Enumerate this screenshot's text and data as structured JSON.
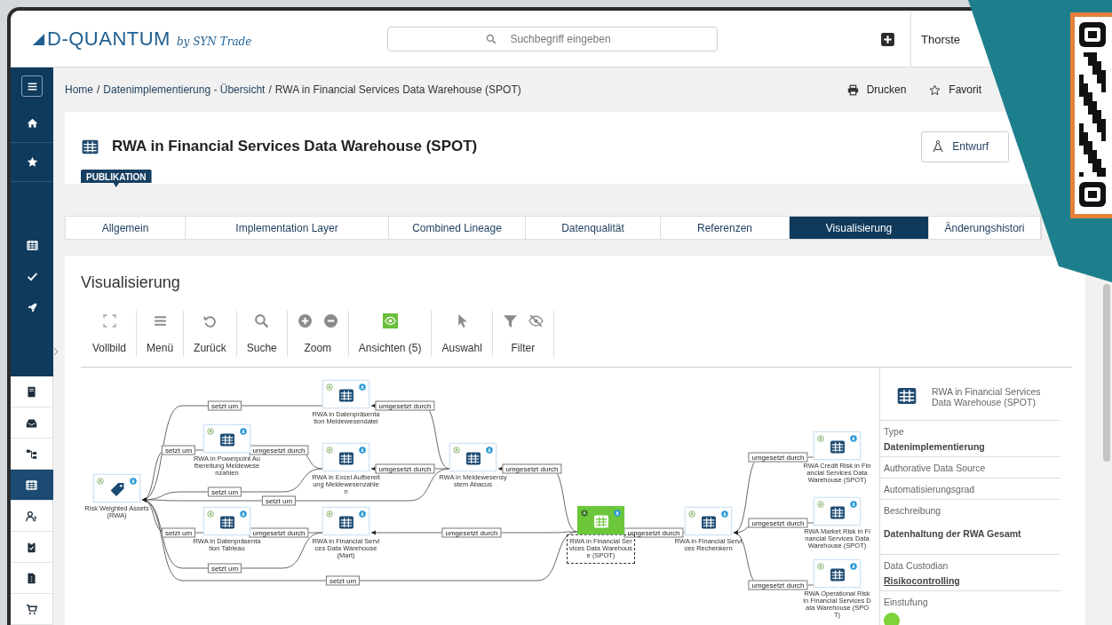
{
  "header": {
    "logo": "D-QUANTUM",
    "logo_tagline": "by SYN Trade",
    "search": {
      "placeholder": "Suchbegriff eingeben"
    },
    "user": "Thorste"
  },
  "sidebar": {
    "sections": [
      {
        "items": [
          {
            "selected": false
          },
          {
            "selected": false
          },
          {
            "selected": false
          }
        ]
      },
      {
        "items": [
          {
            "selected": false
          },
          {
            "selected": false
          },
          {
            "selected": false
          }
        ]
      },
      {
        "items": [
          {
            "selected": false
          },
          {
            "selected": false
          },
          {
            "selected": false
          },
          {
            "selected": true
          },
          {
            "selected": false
          },
          {
            "selected": false
          },
          {
            "selected": false
          },
          {
            "selected": false
          }
        ]
      }
    ]
  },
  "breadcrumb": [
    {
      "kind": "link",
      "label": "Home"
    },
    {
      "kind": "separator",
      "label": "/"
    },
    {
      "kind": "link",
      "label": "Datenimplementierung - Übersicht"
    },
    {
      "kind": "separator",
      "label": "/"
    },
    {
      "kind": "current",
      "label": "RWA in Financial Services Data Warehouse (SPOT)"
    }
  ],
  "actions": [
    "Drucken",
    "Favorit"
  ],
  "page": {
    "title": "RWA in Financial Services Data Warehouse (SPOT)",
    "status_badge": "PUBLIKATION",
    "button": "Entwurf"
  },
  "tabs": [
    {
      "label": "Allgemein",
      "selected": false
    },
    {
      "label": "Implementation Layer",
      "selected": false
    },
    {
      "label": "Combined Lineage",
      "selected": false
    },
    {
      "label": "Datenqualität",
      "selected": false
    },
    {
      "label": "Referenzen",
      "selected": false
    },
    {
      "label": "Visualisierung",
      "selected": true
    },
    {
      "label": "Änderungshistori",
      "selected": false
    }
  ],
  "visualization": {
    "heading": "Visualisierung",
    "toolbar": [
      {
        "label": "Vollbild",
        "active": false
      },
      {
        "label": "Menü",
        "active": false
      },
      {
        "label": "Zurück",
        "active": false
      },
      {
        "label": "Suche",
        "active": false
      },
      {
        "label": "Zoom",
        "active": false
      },
      {
        "label": "Ansichten (5)",
        "active": true
      },
      {
        "label": "Auswahl",
        "active": false
      },
      {
        "label": "Filter",
        "active": false
      }
    ],
    "graph": {
      "nodes": [
        {
          "kind": "asset",
          "label": "Risk Weighted Assets (RWA)",
          "selected": false
        },
        {
          "kind": "implementation",
          "label": "RWA in Datenpräsentation Meldewesendatei",
          "selected": false
        },
        {
          "kind": "implementation",
          "label": "RWA in Powerpoint Aufbereitung Meldewesenzahlen",
          "selected": false
        },
        {
          "kind": "implementation",
          "label": "RWA in Excel Aufbereitung Meldewesenzahlen",
          "selected": false
        },
        {
          "kind": "implementation",
          "label": "RWA in Datenpräsentation Tableau",
          "selected": false
        },
        {
          "kind": "implementation",
          "label": "RWA in Financial Services Data Warehouse (Mart)",
          "selected": false
        },
        {
          "kind": "implementation",
          "label": "RWA in Meldewesensystem Abacus",
          "selected": false
        },
        {
          "kind": "implementation",
          "label": "RWA in Financial Services Data Warehouse (SPOT)",
          "selected": true
        },
        {
          "kind": "implementation",
          "label": "RWA in Financial Services Rechenkern",
          "selected": false
        },
        {
          "kind": "implementation",
          "label": "RWA Credit Risk in Financial Services Data Warehouse (SPOT)",
          "selected": false
        },
        {
          "kind": "implementation",
          "label": "RWA Market Risk in Financial Services Data Warehouse (SPOT)",
          "selected": false
        },
        {
          "kind": "implementation",
          "label": "RWA Operational Risk in Financial Services Data Warehouse (SPOT)",
          "selected": false
        }
      ],
      "edges": [
        {
          "label": "setzt um"
        },
        {
          "label": "setzt um"
        },
        {
          "label": "umgesetzt durch"
        },
        {
          "label": "setzt um"
        },
        {
          "label": "setzt um"
        },
        {
          "label": "umgesetzt durch"
        },
        {
          "label": "umgesetzt durch"
        },
        {
          "label": "umgesetzt durch"
        },
        {
          "label": "setzt um"
        },
        {
          "label": "umgesetzt durch"
        },
        {
          "label": "umgesetzt durch"
        },
        {
          "label": "setzt um"
        },
        {
          "label": "setzt um"
        },
        {
          "label": "umgesetzt durch"
        },
        {
          "label": "umgesetzt durch"
        },
        {
          "label": "umgesetzt durch"
        },
        {
          "label": "umgesetzt durch"
        }
      ]
    },
    "details": {
      "title": "RWA in Financial Services Data Warehouse (SPOT)",
      "fields": [
        {
          "label": "Type",
          "value": "Datenimplementierung"
        },
        {
          "label": "Authorative Data Source"
        },
        {
          "label": "Automatisierungsgrad"
        },
        {
          "label": "Beschreibung",
          "value": "Datenhaltung der RWA Gesamt"
        },
        {
          "label": "Data Custodian",
          "value": "Risikocontrolling",
          "link": true
        },
        {
          "label": "Einstufung",
          "color": "#7ed33a"
        }
      ]
    }
  }
}
